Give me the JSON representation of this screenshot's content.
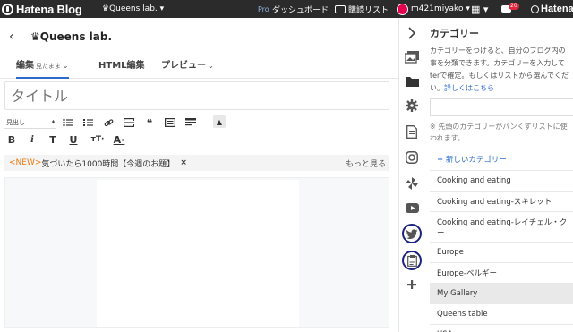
{
  "topbar": {
    "logo": "Hatena Blog",
    "blog_selector": "♛Queens lab. ▾",
    "pro_label": "Pro",
    "dashboard": "ダッシュボード",
    "reading_list": "購読リスト",
    "username": "m421miyako ▾",
    "grid": "▦ ▾",
    "badge_count": "20",
    "hatena": "Hatena"
  },
  "header": {
    "back": "‹",
    "blog_title": "♛Queens lab.",
    "tabs": [
      {
        "label": "編集",
        "sub": "見たまま",
        "chevron": "⌄"
      },
      {
        "label": "HTML編集"
      },
      {
        "label": "プレビュー",
        "chevron": "⌄"
      }
    ]
  },
  "editor": {
    "title_placeholder": "タイトル",
    "heading_select": "見出し",
    "heading_chevron": "⬧",
    "toolbar": {
      "up": "▲",
      "bold": "B",
      "italic": "i",
      "strike": "T",
      "underline": "U",
      "fontsize": "тT·",
      "color": "A·"
    },
    "topic_new": "<NEW>",
    "topic_text": "気づいたら1000時間【今週のお題】",
    "topic_close": "×",
    "topic_more": "もっと見る"
  },
  "sidebar": {
    "icons": [
      "chevron-right-icon",
      "photo-icon",
      "folder-icon",
      "gear-icon",
      "document-icon",
      "instagram-icon",
      "pinwheel-icon",
      "youtube-icon",
      "twitter-icon",
      "clipboard-icon",
      "plus-icon"
    ]
  },
  "panel": {
    "title": "カテゴリー",
    "desc_lines": [
      "カテゴリーをつけると、自分のブログ内の",
      "事を分類できます。カテゴリーを入力して",
      "terで確定。もしくはリストから選んでくだ"
    ],
    "desc_tail": "い。",
    "desc_link": "詳しくはこちら",
    "note_lines": [
      "※ 先頭のカテゴリーがパンくずリストに使",
      "われます。"
    ],
    "new_category": "新しいカテゴリー",
    "categories": [
      "Cooking and eating",
      "Cooking and eating-スキレット",
      "Cooking and eating-レイチェル・ク",
      "Europe",
      "Europe-ベルギー",
      "My Gallery",
      "Queens table",
      "USA"
    ],
    "category_cont": "ー"
  },
  "colors": {
    "topbar": "#2b2b2b",
    "accent": "#2a6bc9",
    "topic_new": "#ee7a12",
    "circle": "#1a237e"
  }
}
